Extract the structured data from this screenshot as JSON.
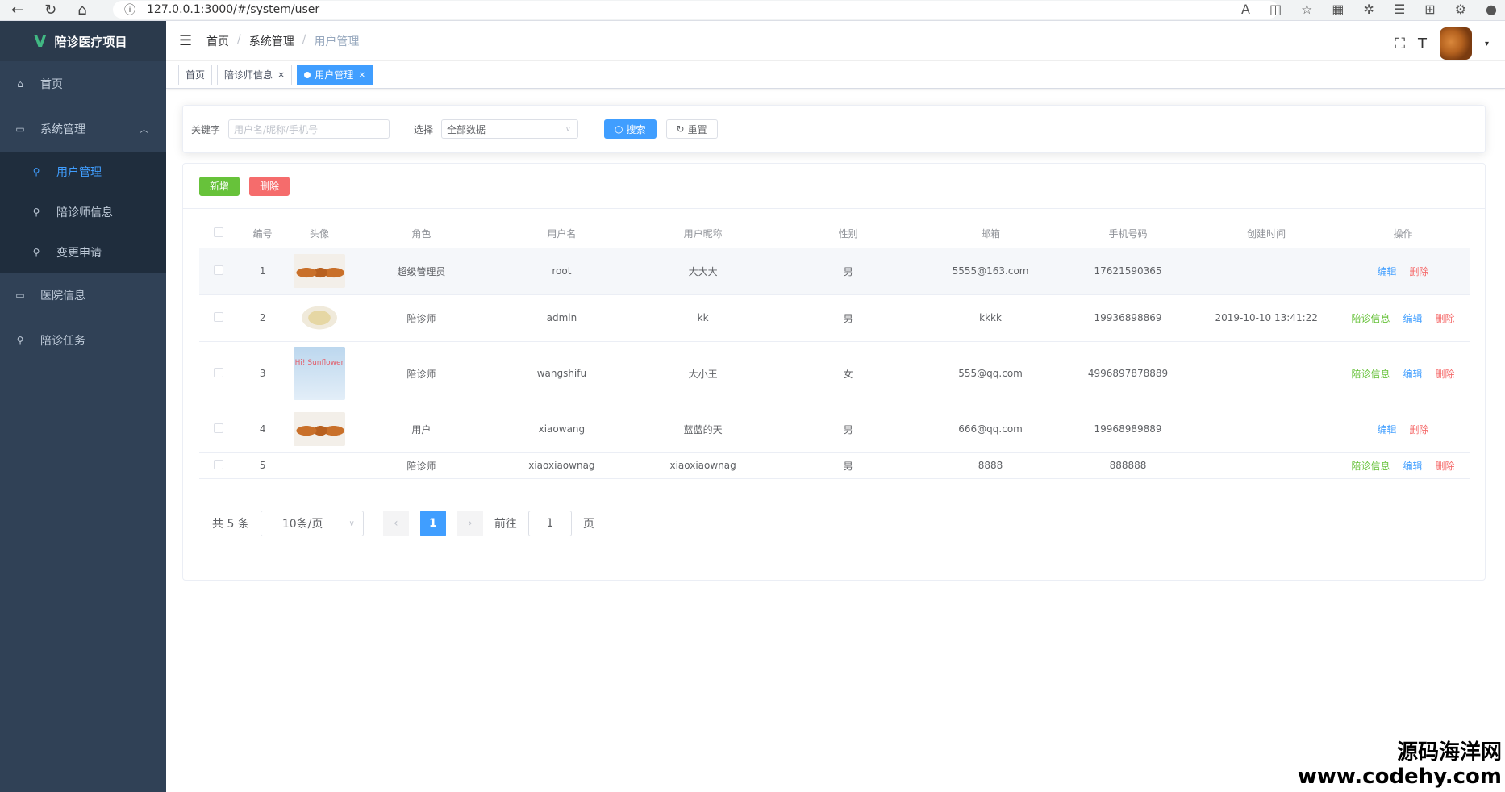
{
  "browser": {
    "url": "127.0.0.1:3000/#/system/user"
  },
  "app": {
    "title": "陪诊医疗项目",
    "logo_glyph": "V"
  },
  "sidebar": {
    "items": [
      {
        "label": "首页",
        "icon": "home-icon"
      },
      {
        "label": "系统管理",
        "icon": "monitor-icon",
        "expanded": true
      },
      {
        "label": "医院信息",
        "icon": "monitor-icon"
      },
      {
        "label": "陪诊任务",
        "icon": "user-group-icon"
      }
    ],
    "sub_items": [
      {
        "label": "用户管理",
        "icon": "user-icon",
        "active": true
      },
      {
        "label": "陪诊师信息",
        "icon": "user-icon"
      },
      {
        "label": "变更申请",
        "icon": "user-icon"
      }
    ]
  },
  "breadcrumb": [
    "首页",
    "系统管理",
    "用户管理"
  ],
  "tags": [
    {
      "label": "首页",
      "closable": false
    },
    {
      "label": "陪诊师信息",
      "closable": true
    },
    {
      "label": "用户管理",
      "closable": true,
      "active": true
    }
  ],
  "search": {
    "keyword_label": "关键字",
    "keyword_placeholder": "用户名/昵称/手机号",
    "select_label": "选择",
    "select_value": "全部数据",
    "search_button": "搜索",
    "reset_button": "重置"
  },
  "toolbar": {
    "add_label": "新增",
    "delete_label": "删除"
  },
  "table": {
    "columns": [
      "编号",
      "头像",
      "角色",
      "用户名",
      "用户昵称",
      "性别",
      "邮箱",
      "手机号码",
      "创建时间",
      "操作"
    ],
    "rows": [
      {
        "id": "1",
        "avatar": "food",
        "role": "超级管理员",
        "username": "root",
        "nickname": "大大大",
        "gender": "男",
        "email": "5555@163.com",
        "phone": "17621590365",
        "created": "",
        "actions": [
          "编辑",
          "删除"
        ]
      },
      {
        "id": "2",
        "avatar": "pasta",
        "role": "陪诊师",
        "username": "admin",
        "nickname": "kk",
        "gender": "男",
        "email": "kkkk",
        "phone": "19936898869",
        "created": "2019-10-10 13:41:22",
        "actions": [
          "陪诊信息",
          "编辑",
          "删除"
        ]
      },
      {
        "id": "3",
        "avatar": "sky",
        "avatar_text": "Hi! Sunflower",
        "role": "陪诊师",
        "username": "wangshifu",
        "nickname": "大小王",
        "gender": "女",
        "email": "555@qq.com",
        "phone": "4996897878889",
        "created": "",
        "actions": [
          "陪诊信息",
          "编辑",
          "删除"
        ]
      },
      {
        "id": "4",
        "avatar": "food",
        "role": "用户",
        "username": "xiaowang",
        "nickname": "蓝蓝的天",
        "gender": "男",
        "email": "666@qq.com",
        "phone": "19968989889",
        "created": "",
        "actions": [
          "编辑",
          "删除"
        ]
      },
      {
        "id": "5",
        "avatar": "",
        "role": "陪诊师",
        "username": "xiaoxiaownag",
        "nickname": "xiaoxiaownag",
        "gender": "男",
        "email": "8888",
        "phone": "888888",
        "created": "",
        "actions": [
          "陪诊信息",
          "编辑",
          "删除"
        ]
      }
    ]
  },
  "pagination": {
    "total_text": "共 5 条",
    "page_size": "10条/页",
    "current": "1",
    "goto_label": "前往",
    "goto_value": "1",
    "page_suffix": "页"
  },
  "watermark": {
    "cn": "源码海洋网",
    "en": "www.codehy.com"
  }
}
